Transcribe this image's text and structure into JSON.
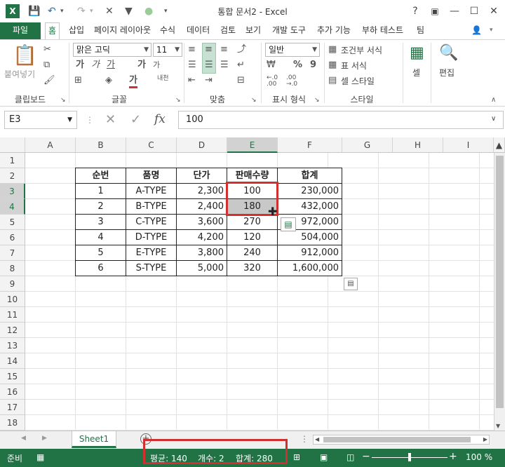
{
  "titlebar": {
    "title": "통합 문서2 - Excel",
    "help": "?",
    "restore": "▣",
    "minimize": "—",
    "maximize": "☐",
    "close": "✕"
  },
  "tabs": [
    "파일",
    "홈",
    "삽입",
    "페이지 레이아웃",
    "수식",
    "데이터",
    "검토",
    "보기",
    "개발 도구",
    "추가 기능",
    "부하 테스트",
    "팀"
  ],
  "ribbon": {
    "clipboard": {
      "paste": "붙여넣기",
      "label": "클립보드"
    },
    "font": {
      "name": "맑은 고딕",
      "size": "11",
      "label": "글꼴",
      "bold": "가",
      "italic": "가",
      "underline": "가",
      "grow": "가",
      "shrink": "가",
      "font_color": "가",
      "phonetic": "내천"
    },
    "alignment": {
      "label": "맞춤"
    },
    "number": {
      "format": "일반",
      "label": "표시 형식",
      "percent": "%",
      "comma": "9",
      "inc": "←.0\n.00",
      "dec": ".00\n→.0"
    },
    "styles": {
      "conditional": "조건부 서식",
      "table": "표 서식",
      "cell": "셀 스타일",
      "label": "스타일"
    },
    "cells": {
      "label": "셀"
    },
    "editing": {
      "label": "편집"
    }
  },
  "formula_bar": {
    "name_box": "E3",
    "value": "100",
    "fx": "fx"
  },
  "columns": [
    "A",
    "B",
    "C",
    "D",
    "E",
    "F",
    "G",
    "H",
    "I"
  ],
  "rows": [
    "1",
    "2",
    "3",
    "4",
    "5",
    "6",
    "7",
    "8",
    "9",
    "10",
    "11",
    "12",
    "13",
    "14",
    "15",
    "16",
    "17",
    "18"
  ],
  "table": {
    "headers": [
      "순번",
      "품명",
      "단가",
      "판매수량",
      "합계"
    ],
    "rows": [
      [
        "1",
        "A-TYPE",
        "2,300",
        "100",
        "230,000"
      ],
      [
        "2",
        "B-TYPE",
        "2,400",
        "180",
        "432,000"
      ],
      [
        "3",
        "C-TYPE",
        "3,600",
        "270",
        "972,000"
      ],
      [
        "4",
        "D-TYPE",
        "4,200",
        "120",
        "504,000"
      ],
      [
        "5",
        "E-TYPE",
        "3,800",
        "240",
        "912,000"
      ],
      [
        "6",
        "S-TYPE",
        "5,000",
        "320",
        "1,600,000"
      ]
    ]
  },
  "sheet": {
    "tab": "Sheet1"
  },
  "status": {
    "ready": "준비",
    "average": "평균: 140",
    "count": "개수: 2",
    "sum": "합계: 280",
    "zoom": "100 %"
  },
  "colors": {
    "accent": "#217346",
    "highlight": "#d32f2f"
  }
}
